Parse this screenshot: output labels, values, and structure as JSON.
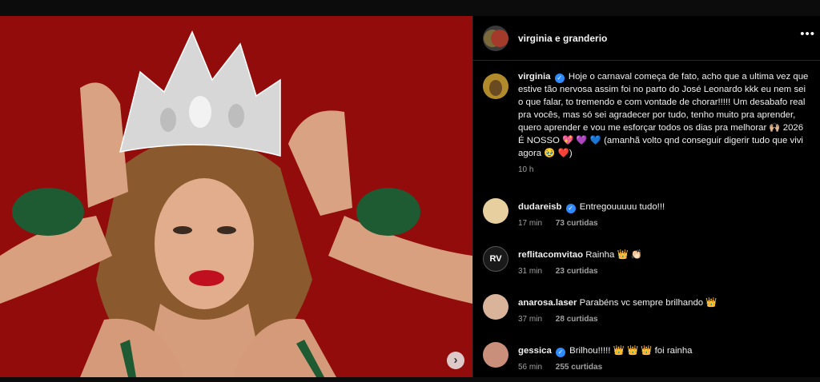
{
  "post": {
    "header_title": "virginia e granderio",
    "more_icon": "more-horizontal-icon",
    "next_icon": "chevron-right-icon"
  },
  "caption": {
    "username": "virginia",
    "text": "Hoje o carnaval começa de fato, acho que a ultima vez que estive tão nervosa assim foi no parto do José Leonardo kkk eu nem sei o que falar, to tremendo e com vontade de chorar!!!!! Um desabafo real pra vocês, mas só sei agradecer por tudo, tenho muito pra aprender, quero aprender e vou me esforçar todos os dias pra melhorar 🙌🏼 2026 É NOSSO 💖 💜 💙 (amanhã volto qnd conseguir digerir tudo que vivi agora 🥹 ❤️)",
    "time": "10 h"
  },
  "comments": [
    {
      "username": "dudareisb",
      "verified": true,
      "text": "Entregouuuuu tudo!!!",
      "time": "17 min",
      "likes": "73 curtidas",
      "avatar_color": "#e8cfa0"
    },
    {
      "username": "reflitacomvitao",
      "verified": false,
      "text": "Rainha 👑 👏🏻",
      "time": "31 min",
      "likes": "23 curtidas",
      "avatar_color": "#1a1a1a",
      "avatar_text": "RV"
    },
    {
      "username": "anarosa.laser",
      "verified": false,
      "text": "Parabéns vc sempre brilhando 👑",
      "time": "37 min",
      "likes": "28 curtidas",
      "avatar_color": "#d9b49a"
    },
    {
      "username": "gessica",
      "verified": true,
      "text": "Brilhou!!!!! 👑 👑 👑 foi rainha",
      "time": "56 min",
      "likes": "255 curtidas",
      "avatar_color": "#c98f7a"
    }
  ],
  "colors": {
    "photo_background": "#8a0a0a",
    "verified_badge": "#2f8bff"
  }
}
